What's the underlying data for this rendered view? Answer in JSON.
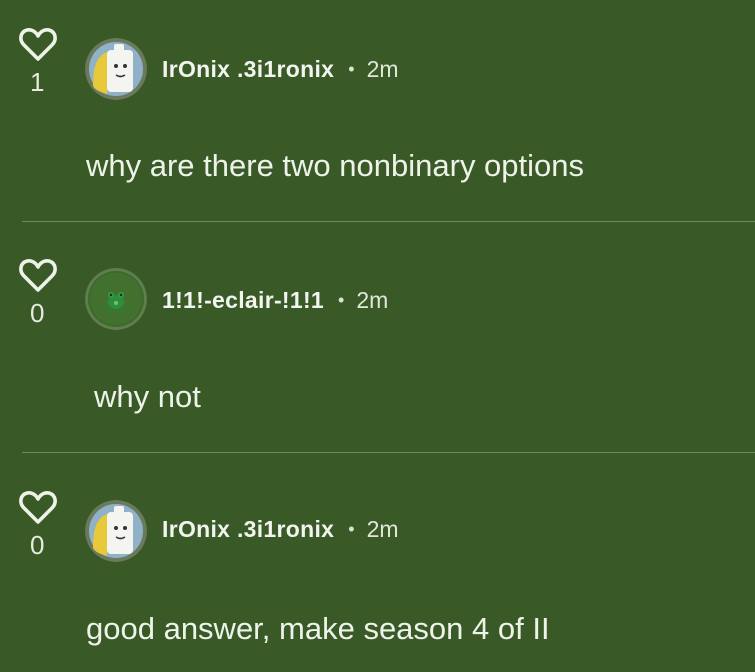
{
  "comments": [
    {
      "username": "IrOnix .3i1ronix",
      "time": "2m",
      "likes": "1",
      "text": "why are there two nonbinary options",
      "avatar_icon": "cartoon-character-avatar-icon"
    },
    {
      "username": "1!1!-eclair-!1!1",
      "time": "2m",
      "likes": "0",
      "text": "why not",
      "avatar_icon": "green-creature-avatar-icon"
    },
    {
      "username": "IrOnix .3i1ronix",
      "time": "2m",
      "likes": "0",
      "text": "good answer, make season 4 of II",
      "avatar_icon": "cartoon-character-avatar-icon"
    }
  ],
  "separator": "•",
  "colors": {
    "background": "#395a27",
    "divider": "#6f8a60",
    "text": "#eef3ea"
  }
}
